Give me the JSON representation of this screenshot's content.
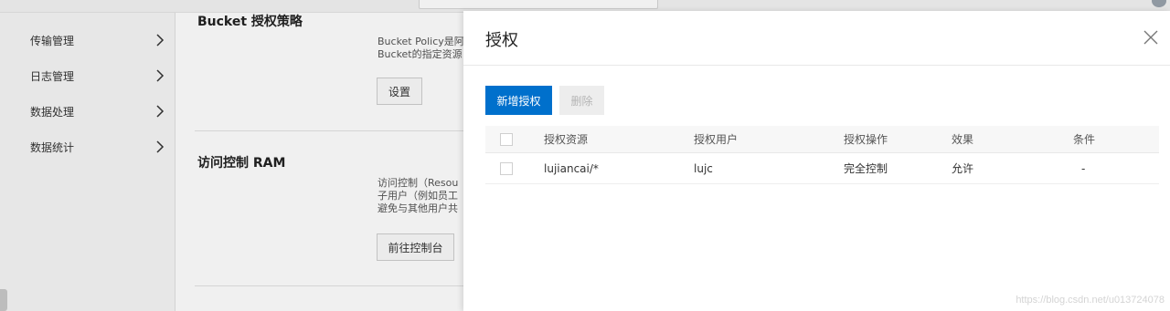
{
  "sidebar": {
    "items": [
      {
        "label": "传输管理"
      },
      {
        "label": "日志管理"
      },
      {
        "label": "数据处理"
      },
      {
        "label": "数据统计"
      }
    ]
  },
  "content": {
    "bucket_policy": {
      "title": "Bucket 授权策略",
      "desc_lines": [
        "Bucket Policy是阿",
        "Bucket的指定资源"
      ],
      "button": "设置"
    },
    "ram": {
      "title": "访问控制 RAM",
      "desc_lines": [
        "访问控制（Resou",
        "子用户（例如员工",
        "避免与其他用户共"
      ],
      "button": "前往控制台"
    }
  },
  "drawer": {
    "title": "授权",
    "toolbar": {
      "add_label": "新增授权",
      "delete_label": "删除"
    },
    "table": {
      "columns": [
        "授权资源",
        "授权用户",
        "授权操作",
        "效果",
        "条件"
      ],
      "rows": [
        {
          "resource": "lujiancai/*",
          "user": "lujc",
          "action": "完全控制",
          "effect": "允许",
          "condition": "-"
        }
      ]
    }
  },
  "watermark": "https://blog.csdn.net/u013724078",
  "colors": {
    "primary": "#0070cc",
    "disabled_bg": "#ededed"
  }
}
